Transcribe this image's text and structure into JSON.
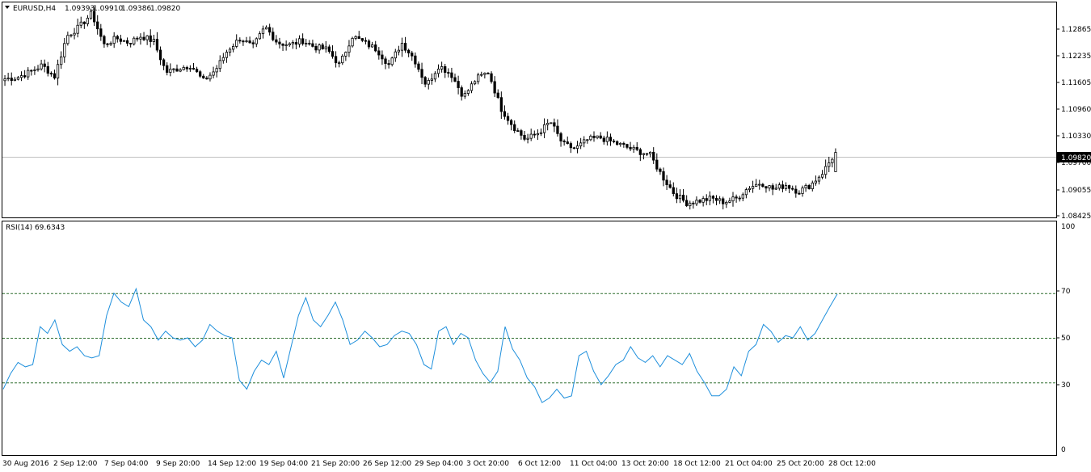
{
  "header": {
    "symbol": "EURUSD,H4",
    "open": "1.09393",
    "high": "1.09910",
    "low": "1.09386",
    "close": "1.09820"
  },
  "price_axis": {
    "ticks": [
      "1.12865",
      "1.12235",
      "1.11605",
      "1.10960",
      "1.10330",
      "1.09700",
      "1.09055",
      "1.08425"
    ],
    "current_price_label": "1.09820"
  },
  "rsi": {
    "label": "RSI(14) 69.6343",
    "levels": [
      70,
      50,
      30
    ],
    "axis_ticks": [
      "100",
      "70",
      "50",
      "30",
      "0"
    ]
  },
  "time_axis": {
    "labels": [
      "30 Aug 2016",
      "2 Sep 12:00",
      "7 Sep 04:00",
      "9 Sep 20:00",
      "14 Sep 12:00",
      "19 Sep 04:00",
      "21 Sep 20:00",
      "26 Sep 12:00",
      "29 Sep 04:00",
      "3 Oct 20:00",
      "6 Oct 12:00",
      "11 Oct 04:00",
      "13 Oct 20:00",
      "18 Oct 12:00",
      "21 Oct 04:00",
      "25 Oct 20:00",
      "28 Oct 12:00"
    ]
  },
  "colors": {
    "rsi_line": "#1e8fdc",
    "candle": "#000000",
    "level_line": "#2f6f2f",
    "price_line": "#c0c0c0"
  },
  "chart_data": [
    {
      "type": "candlestick",
      "title": "EURUSD,H4",
      "ylim": [
        1.0838,
        1.1316
      ],
      "x": [
        "30 Aug 2016",
        "2 Sep 12:00",
        "7 Sep 04:00",
        "9 Sep 20:00",
        "14 Sep 12:00",
        "19 Sep 04:00",
        "21 Sep 20:00",
        "26 Sep 12:00",
        "29 Sep 04:00",
        "3 Oct 20:00",
        "6 Oct 12:00",
        "11 Oct 04:00",
        "13 Oct 20:00",
        "18 Oct 12:00",
        "21 Oct 04:00",
        "25 Oct 20:00",
        "28 Oct 12:00"
      ],
      "close_path": [
        1.1145,
        1.1148,
        1.116,
        1.1175,
        1.115,
        1.124,
        1.126,
        1.129,
        1.122,
        1.1235,
        1.1225,
        1.124,
        1.1228,
        1.116,
        1.1168,
        1.1175,
        1.114,
        1.1165,
        1.121,
        1.1235,
        1.1215,
        1.126,
        1.1225,
        1.122,
        1.123,
        1.1215,
        1.121,
        1.1175,
        1.124,
        1.1225,
        1.121,
        1.1175,
        1.1225,
        1.119,
        1.113,
        1.1175,
        1.1155,
        1.1105,
        1.1145,
        1.116,
        1.108,
        1.104,
        1.101,
        1.1025,
        1.105,
        1.1,
        1.099,
        1.101,
        1.1015,
        1.1005,
        1.0995,
        1.0985,
        1.0978,
        1.093,
        1.089,
        1.087,
        1.0875,
        1.088,
        1.0872,
        1.088,
        1.0905,
        1.0915,
        1.09,
        1.091,
        1.0895,
        1.091,
        1.0939,
        1.0982
      ],
      "last": {
        "open": 1.09393,
        "high": 1.0991,
        "low": 1.09386,
        "close": 1.0982
      },
      "current_price": 1.0982,
      "yticks": [
        1.12865,
        1.12235,
        1.11605,
        1.1096,
        1.1033,
        1.097,
        1.09055,
        1.08425
      ]
    },
    {
      "type": "line",
      "title": "RSI(14) 69.6343",
      "ylim": [
        0,
        100
      ],
      "levels": [
        70,
        50,
        30
      ],
      "values": [
        27,
        34,
        39,
        37,
        38,
        55,
        52,
        58,
        47,
        44,
        46,
        42,
        41,
        42,
        60,
        70,
        66,
        64,
        72,
        58,
        55,
        49,
        53,
        50,
        49,
        50,
        46,
        49,
        56,
        53,
        51,
        50,
        31,
        27,
        35,
        40,
        38,
        44,
        32,
        46,
        60,
        68,
        58,
        55,
        60,
        66,
        58,
        47,
        49,
        53,
        50,
        46,
        47,
        51,
        53,
        52,
        47,
        38,
        36,
        53,
        55,
        47,
        52,
        50,
        40,
        34,
        30,
        35,
        55,
        45,
        40,
        32,
        28,
        21,
        23,
        27,
        23,
        24,
        42,
        44,
        35,
        29,
        33,
        38,
        40,
        46,
        41,
        39,
        42,
        37,
        42,
        40,
        38,
        43,
        35,
        30,
        24,
        24,
        27,
        37,
        33,
        44,
        47,
        56,
        53,
        48,
        51,
        50,
        55,
        49,
        52,
        58,
        64,
        69.6
      ]
    }
  ]
}
